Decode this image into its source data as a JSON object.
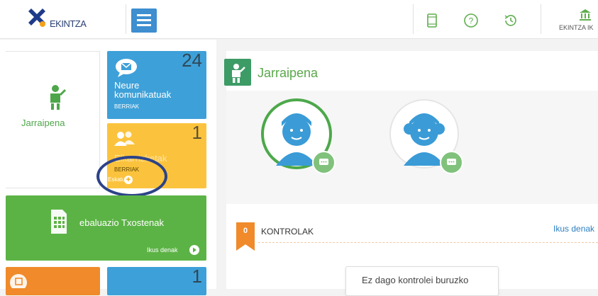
{
  "header": {
    "logo_text": "EKINTZA",
    "institution_label": "EKINTZA IK"
  },
  "sidebar": {
    "main_card_label": "Jarraipena",
    "tiles": [
      {
        "title": "Neure komunikatuak",
        "count": "24",
        "badge": "BERRIAK",
        "color": "#3ea0d8"
      },
      {
        "title": "Elkarrizketak",
        "count": "1",
        "badge": "BERRIAK",
        "action": "Eskatu",
        "color": "#fbc33d"
      },
      {
        "title": "ebaluazio Txostenak",
        "action": "Ikus denak",
        "color": "#5cb345"
      },
      {
        "count": "1",
        "color": "#3ea0d8"
      }
    ]
  },
  "main": {
    "title": "Jarraipena",
    "kontrolak": {
      "count": "0",
      "title": "KONTROLAK",
      "link": "Ikus denak",
      "empty_message": "Ez dago kontrolei buruzko"
    }
  },
  "colors": {
    "accent_blue": "#3ea0d8",
    "accent_green": "#5cb345",
    "accent_yellow": "#fbc33d",
    "accent_orange": "#f08a2a",
    "highlight_ring": "#2c4389"
  }
}
